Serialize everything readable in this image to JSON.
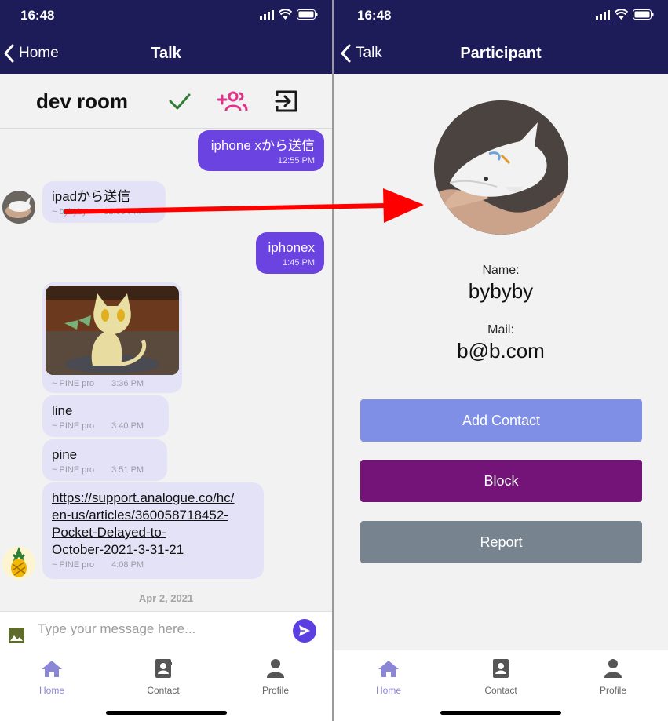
{
  "status": {
    "time": "16:48"
  },
  "left": {
    "nav": {
      "back_label": "Home",
      "title": "Talk"
    },
    "room": {
      "title": "dev room"
    },
    "messages": [
      {
        "text": "iphone xから送信",
        "time": "12:55 PM"
      },
      {
        "text": "ipadから送信",
        "sender": "~ bybyby",
        "time": "12:55 PM"
      },
      {
        "text": "iphonex",
        "time": "1:45 PM"
      },
      {
        "sender": "~ PINE pro",
        "time": "3:36 PM"
      },
      {
        "text": "line",
        "sender": "~ PINE pro",
        "time": "3:40 PM"
      },
      {
        "text": "pine",
        "sender": "~ PINE pro",
        "time": "3:51 PM"
      },
      {
        "text": "https://support.analogue.co/hc/en-us/articles/360058718452-Pocket-Delayed-to-October-2021-3-31-21",
        "line1": "https://support.analogue.co/hc/",
        "line2": "en-us/articles/360058718452-",
        "line3": "Pocket-Delayed-to-",
        "line4": "October-2021-3-31-21",
        "sender": "~ PINE pro",
        "time": "4:08 PM"
      }
    ],
    "date_separator": "Apr 2, 2021",
    "composer": {
      "placeholder": "Type your message here..."
    }
  },
  "right": {
    "nav": {
      "back_label": "Talk",
      "title": "Participant"
    },
    "name_label": "Name:",
    "name_value": "bybyby",
    "mail_label": "Mail:",
    "mail_value": "b@b.com",
    "buttons": {
      "add_contact": "Add Contact",
      "block": "Block",
      "report": "Report"
    }
  },
  "tabs": [
    {
      "label": "Home",
      "icon": "home-icon"
    },
    {
      "label": "Contact",
      "icon": "contact-book-icon"
    },
    {
      "label": "Profile",
      "icon": "person-icon"
    }
  ],
  "colors": {
    "nav_bg": "#1e1b59",
    "my_bubble": "#6a43e0",
    "their_bubble": "#e4e2f7",
    "add_contact": "#7f8fe6",
    "block": "#741478",
    "report": "#77838f",
    "annotation_arrow": "#ff0000"
  }
}
